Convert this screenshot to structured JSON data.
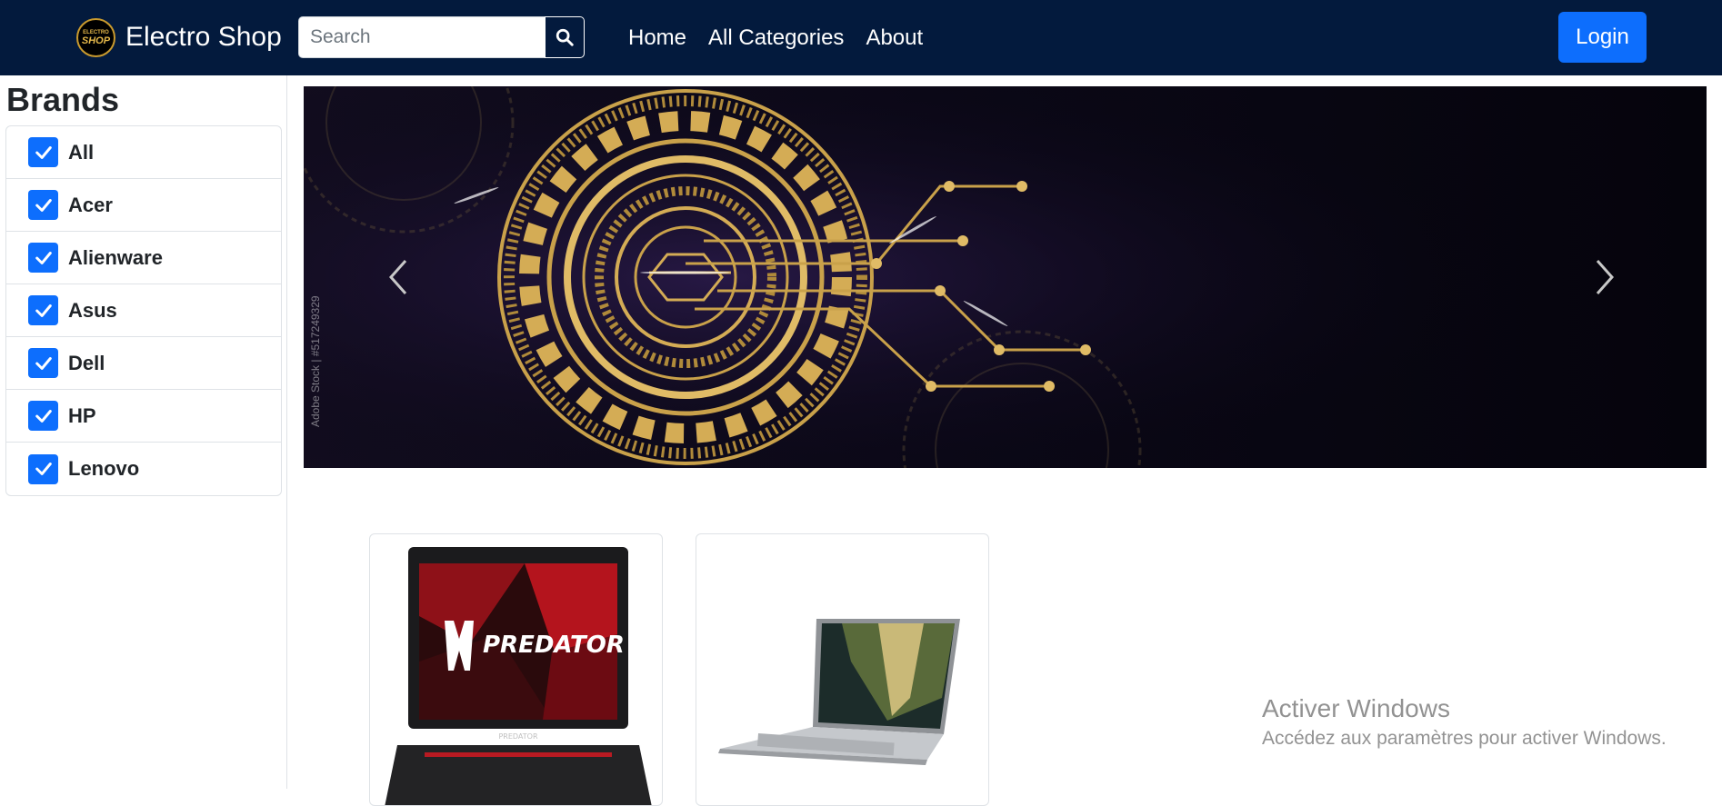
{
  "navbar": {
    "logo_line1": "ELECTRO",
    "logo_line2": "SHOP",
    "brand_name": "Electro Shop",
    "search_placeholder": "Search",
    "links": [
      "Home",
      "All Categories",
      "About"
    ],
    "login_label": "Login"
  },
  "sidebar": {
    "title": "Brands",
    "brands": [
      {
        "label": "All",
        "checked": true
      },
      {
        "label": "Acer",
        "checked": true
      },
      {
        "label": "Alienware",
        "checked": true
      },
      {
        "label": "Asus",
        "checked": true
      },
      {
        "label": "Dell",
        "checked": true
      },
      {
        "label": "HP",
        "checked": true
      },
      {
        "label": "Lenovo",
        "checked": true
      }
    ]
  },
  "carousel": {
    "side_watermark": "Adobe Stock | #517249329",
    "watermark": "Adobe Stock"
  },
  "products": [
    {
      "screen_text": "PREDATOR",
      "bezel_text": "PREDATOR"
    },
    {
      "screen_text": ""
    }
  ],
  "activation": {
    "title": "Activer Windows",
    "subtitle": "Accédez aux paramètres pour activer Windows."
  },
  "colors": {
    "navbar_bg": "#031a3d",
    "primary": "#0d6efd",
    "gold": "#c9a14a"
  }
}
